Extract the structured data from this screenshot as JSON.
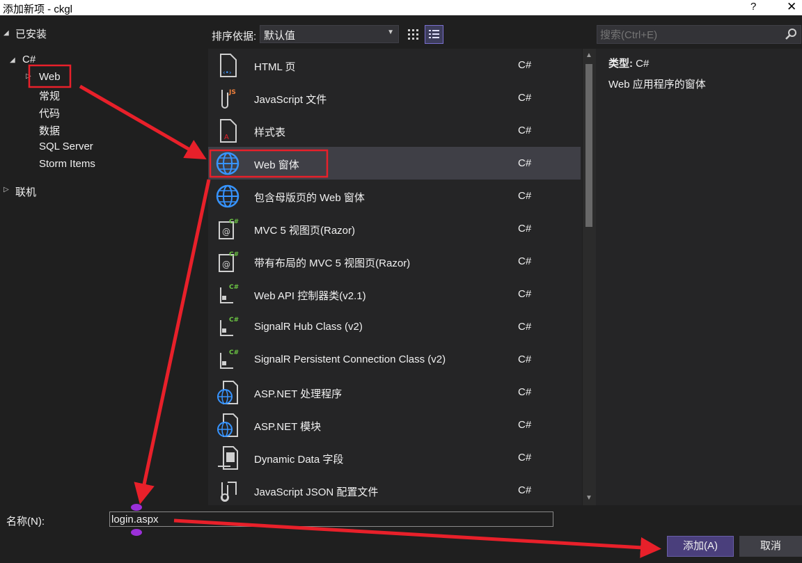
{
  "window": {
    "title": "添加新项 - ckgl",
    "help": "?",
    "close": "✕"
  },
  "tree": {
    "installed": "已安装",
    "csharp": "C#",
    "items": [
      "Web",
      "常规",
      "代码",
      "数据",
      "SQL Server",
      "Storm Items"
    ],
    "online": "联机"
  },
  "toolbar": {
    "sort_label": "排序依据:",
    "sort_value": "默认值"
  },
  "search": {
    "placeholder": "搜索(Ctrl+E)"
  },
  "templates": [
    {
      "name": "HTML 页",
      "lang": "C#",
      "icon": "html-page-icon"
    },
    {
      "name": "JavaScript 文件",
      "lang": "C#",
      "icon": "javascript-file-icon"
    },
    {
      "name": "样式表",
      "lang": "C#",
      "icon": "stylesheet-icon"
    },
    {
      "name": "Web 窗体",
      "lang": "C#",
      "icon": "globe-icon"
    },
    {
      "name": "包含母版页的 Web 窗体",
      "lang": "C#",
      "icon": "globe-icon"
    },
    {
      "name": "MVC 5 视图页(Razor)",
      "lang": "C#",
      "icon": "razor-view-icon"
    },
    {
      "name": "带有布局的 MVC 5 视图页(Razor)",
      "lang": "C#",
      "icon": "razor-view-icon"
    },
    {
      "name": "Web API 控制器类(v2.1)",
      "lang": "C#",
      "icon": "csharp-class-icon"
    },
    {
      "name": "SignalR Hub Class (v2)",
      "lang": "C#",
      "icon": "csharp-class-icon"
    },
    {
      "name": "SignalR Persistent Connection Class (v2)",
      "lang": "C#",
      "icon": "csharp-class-icon"
    },
    {
      "name": "ASP.NET 处理程序",
      "lang": "C#",
      "icon": "globe-file-icon"
    },
    {
      "name": "ASP.NET 模块",
      "lang": "C#",
      "icon": "globe-file-icon"
    },
    {
      "name": "Dynamic Data 字段",
      "lang": "C#",
      "icon": "dynamic-data-icon"
    },
    {
      "name": "JavaScript JSON 配置文件",
      "lang": "C#",
      "icon": "json-config-icon"
    }
  ],
  "details": {
    "type_label": "类型:",
    "type_value": "C#",
    "description": "Web 应用程序的窗体"
  },
  "footer": {
    "name_label": "名称(N):",
    "name_value": "login.aspx",
    "add_label": "添加(A)",
    "cancel_label": "取消"
  },
  "colors": {
    "accent": "#3794ff",
    "selection": "#3f3f46",
    "annotation": "#e8202a"
  }
}
